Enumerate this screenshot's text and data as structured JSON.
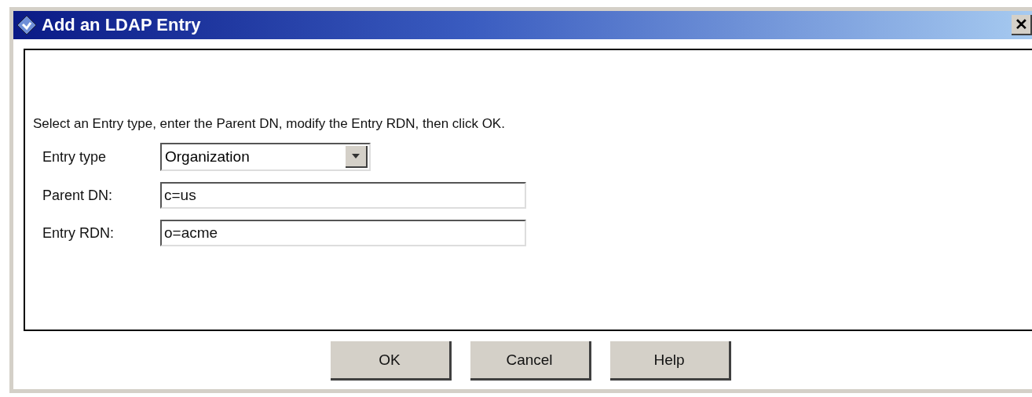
{
  "window": {
    "title": "Add an LDAP Entry",
    "close": "✕"
  },
  "instruction": "Select an Entry type, enter the Parent DN, modify the Entry RDN, then click OK.",
  "fields": [
    {
      "kind": "dropdown",
      "label": "Entry type",
      "value": "Organization"
    },
    {
      "kind": "text",
      "label": "Parent DN:",
      "value": "c=us"
    },
    {
      "kind": "text",
      "label": "Entry RDN:",
      "value": "o=acme"
    }
  ],
  "buttons": [
    "OK",
    "Cancel",
    "Help"
  ]
}
